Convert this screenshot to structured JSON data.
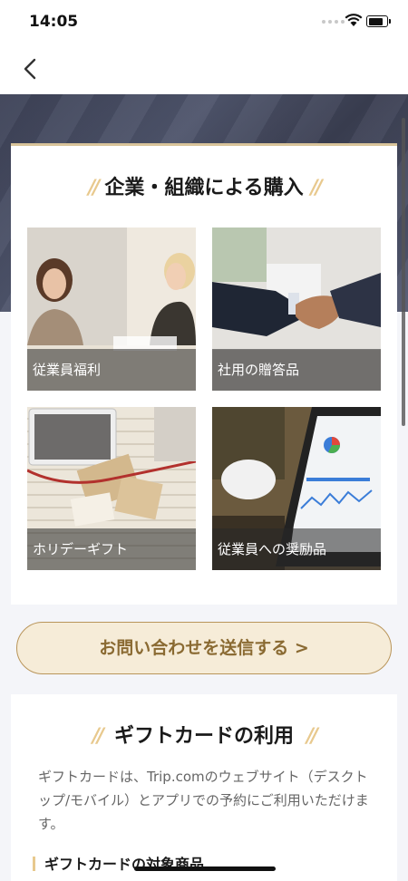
{
  "status_bar": {
    "time": "14:05",
    "battery_level": 0.8
  },
  "nav": {
    "back_icon": "chevron-left-icon"
  },
  "corporate": {
    "title": "企業・組織による購入",
    "tiles": [
      {
        "label": "従業員福利",
        "image": "office-meeting-photo"
      },
      {
        "label": "社用の贈答品",
        "image": "handshake-photo"
      },
      {
        "label": "ホリデーギフト",
        "image": "gift-boxes-photo"
      },
      {
        "label": "従業員への奨励品",
        "image": "analytics-tablet-photo"
      }
    ]
  },
  "inquiry_button": {
    "label": "お問い合わせを送信する >"
  },
  "usage": {
    "title": "ギフトカードの利用",
    "description": "ギフトカードは、Trip.comのウェブサイト（デスクトップ/モバイル）とアプリでの予約にご利用いただけます。",
    "subheading": "ギフトカードの対象商品"
  },
  "colors": {
    "accent_gold": "#b9955a",
    "deco_gold": "#e8c98e",
    "hero_dark": "#3d4257"
  }
}
